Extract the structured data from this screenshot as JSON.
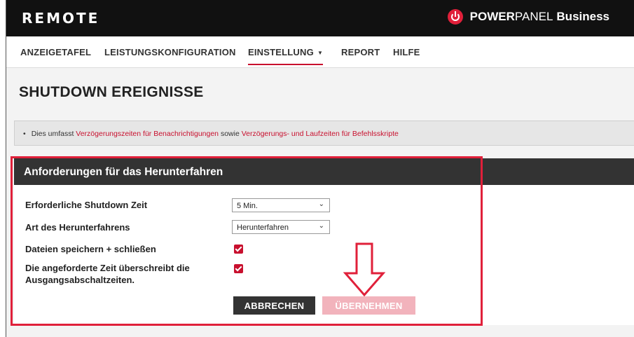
{
  "header": {
    "brand": "REMOTE",
    "logo_strong": "POWER",
    "logo_light": "PANEL",
    "logo_suffix": "Business",
    "logo_icon": "power-icon"
  },
  "nav": {
    "items": [
      {
        "label": "ANZEIGETAFEL"
      },
      {
        "label": "LEISTUNGSKONFIGURATION"
      },
      {
        "label": "EINSTELLUNG",
        "active": true,
        "dropdown": true
      },
      {
        "label": "REPORT"
      },
      {
        "label": "HILFE"
      }
    ]
  },
  "page": {
    "title": "SHUTDOWN EREIGNISSE"
  },
  "info": {
    "prefix": "Dies umfasst ",
    "link1": "Verzögerungszeiten für Benachrichtigungen",
    "middle": " sowie ",
    "link2": "Verzögerungs- und Laufzeiten für Befehlsskripte"
  },
  "panel": {
    "title": "Anforderungen für das Herunterfahren",
    "shutdown_time_label": "Erforderliche Shutdown Zeit",
    "shutdown_time_value": "5 Min.",
    "shutdown_type_label": "Art des Herunterfahrens",
    "shutdown_type_value": "Herunterfahren",
    "save_files_label": "Dateien speichern + schließen",
    "save_files_checked": true,
    "override_label_line1": "Die angeforderte Zeit überschreibt die",
    "override_label_line2": "Ausgangsabschaltzeiten.",
    "override_checked": true,
    "cancel_label": "ABBRECHEN",
    "apply_label": "ÜBERNEHMEN"
  },
  "colors": {
    "accent": "#c8102e",
    "header_bg": "#111111",
    "panel_head_bg": "#333333",
    "annotation": "#e0203a"
  }
}
